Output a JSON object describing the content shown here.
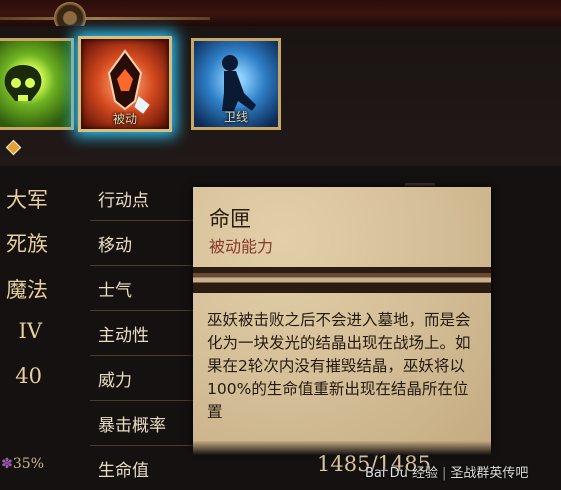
{
  "skills": [
    {
      "name": "",
      "icon": "green-skull-icon"
    },
    {
      "name": "被动",
      "icon": "crystal-icon"
    },
    {
      "name": "卫线",
      "icon": "kneeling-figure-icon"
    }
  ],
  "left_values": {
    "faction": "大军",
    "race": "死族",
    "type": "魔法",
    "tier": "IV",
    "level": "40",
    "percent": "35%"
  },
  "attributes": [
    {
      "label": "行动点"
    },
    {
      "label": "移动"
    },
    {
      "label": "士气"
    },
    {
      "label": "主动性"
    },
    {
      "label": "威力"
    },
    {
      "label": "暴击概率"
    },
    {
      "label": "生命值"
    }
  ],
  "hp_value": "1485/1485",
  "tooltip": {
    "title": "命匣",
    "subtitle": "被动能力",
    "description": "巫妖被击败之后不会进入墓地，而是会化为一块发光的结晶出现在战场上。如果在2轮次内没有摧毁结晶，巫妖将以100%的生命值重新出现在结晶所在位置"
  },
  "watermark": {
    "left": "Bai Du 经验",
    "right": "圣战群英传吧"
  },
  "colors": {
    "accent_gold": "#c9a664",
    "highlight_blue": "#2ec9ff",
    "parchment": "#d7c29c",
    "subtitle_red": "#8a3a24"
  }
}
